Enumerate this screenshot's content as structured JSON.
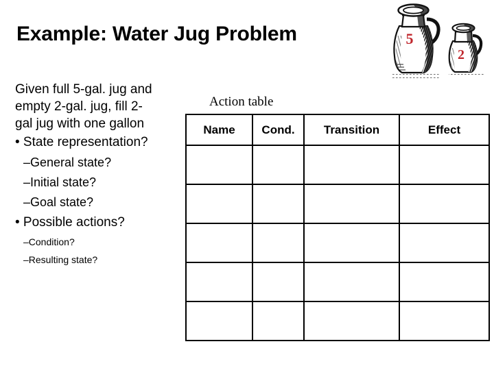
{
  "slide": {
    "title": "Example: Water Jug Problem",
    "background_color": "#ffffff",
    "text_color": "#000000"
  },
  "illustration": {
    "name": "two-water-jugs-engraving",
    "label_color": "#c0272d",
    "jugs": [
      {
        "name": "large-jug",
        "capacity_label": "5"
      },
      {
        "name": "small-jug",
        "capacity_label": "2"
      }
    ]
  },
  "body_text": {
    "lines": [
      {
        "level": "para",
        "text": "Given full 5-gal. jug and"
      },
      {
        "level": "para",
        "text": "empty 2-gal. jug, fill 2-"
      },
      {
        "level": "para",
        "text": "gal jug with one gallon"
      },
      {
        "level": "bullet",
        "text": "• State representation?"
      },
      {
        "level": "dash",
        "text": "–General state?"
      },
      {
        "level": "dash",
        "text": "–Initial state?"
      },
      {
        "level": "dash",
        "text": "–Goal state?"
      },
      {
        "level": "bullet",
        "text": "• Possible actions?"
      },
      {
        "level": "dash-small",
        "text": "–Condition?"
      },
      {
        "level": "dash-small",
        "text": "–Resulting state?"
      }
    ]
  },
  "action_table": {
    "caption": "Action table",
    "columns": [
      "Name",
      "Cond.",
      "Transition",
      "Effect"
    ],
    "rows": [
      [
        "",
        "",
        "",
        ""
      ],
      [
        "",
        "",
        "",
        ""
      ],
      [
        "",
        "",
        "",
        ""
      ],
      [
        "",
        "",
        "",
        ""
      ],
      [
        "",
        "",
        "",
        ""
      ]
    ]
  }
}
